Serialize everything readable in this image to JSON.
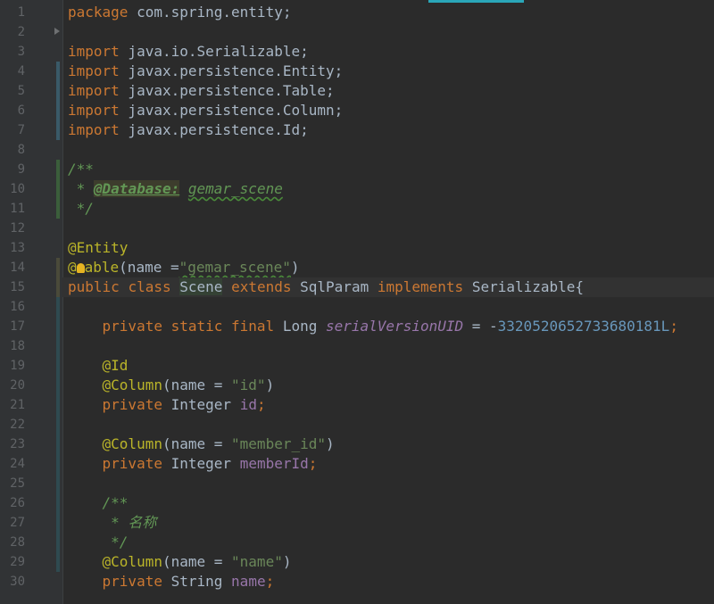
{
  "editor": {
    "line_numbers": [
      "1",
      "2",
      "3",
      "4",
      "5",
      "6",
      "7",
      "8",
      "9",
      "10",
      "11",
      "12",
      "13",
      "14",
      "15",
      "16",
      "17",
      "18",
      "19",
      "20",
      "21",
      "22",
      "23",
      "24",
      "25",
      "26",
      "27",
      "28",
      "29",
      "30"
    ],
    "colors": {
      "background": "#2b2b2b",
      "keyword": "#cc7832",
      "annotation": "#bbb529",
      "string": "#6a8759",
      "number": "#6897bb",
      "field": "#9876aa",
      "comment": "#629755",
      "text": "#a9b7c6"
    },
    "icons": [
      "fold-arrow-icon",
      "lightbulb-icon"
    ]
  },
  "code": {
    "l1_kw": "package",
    "l1_rest": " com.spring.entity;",
    "import_kw": "import",
    "l3_rest": " java.io.Serializable;",
    "l4_rest": " javax.persistence.Entity;",
    "l5_rest": " javax.persistence.Table;",
    "l6_rest": " javax.persistence.Column;",
    "l7_rest": " javax.persistence.Id;",
    "l9": "/**",
    "l10_pre": " * ",
    "l10_tag": "@Database:",
    "l10_sp": " ",
    "l10_val": "gemar_scene",
    "l11": " */",
    "l13": "@Entity",
    "l14_at": "@",
    "l14_rest": "able",
    "l14_args_pre": "(name =",
    "l14_str": "\"gemar_scene\"",
    "l14_args_post": ")",
    "l15_public": "public",
    "l15_class": "class",
    "l15_name": "Scene",
    "l15_extends": "extends",
    "l15_parent": "SqlParam",
    "l15_implements": "implements",
    "l15_iface": "Serializable{",
    "l17_mods": "private static final",
    "l17_type": "Long",
    "l17_field": "serialVersionUID",
    "l17_eq": " = -",
    "l17_num": "3320520652733680181L",
    "l17_end": ";",
    "l19": "@Id",
    "column_ann": "@Column",
    "l20_args_pre": "(name = ",
    "l20_str": "\"id\"",
    "args_post": ")",
    "private_kw": "private",
    "integer_type": "Integer",
    "l21_field": "id",
    "semi": ";",
    "l23_str": "\"member_id\"",
    "l24_field": "memberId",
    "l26": "/**",
    "l27": " * 名称",
    "l28": " */",
    "l29_str": "\"name\"",
    "string_type": "String",
    "l30_field": "name"
  }
}
